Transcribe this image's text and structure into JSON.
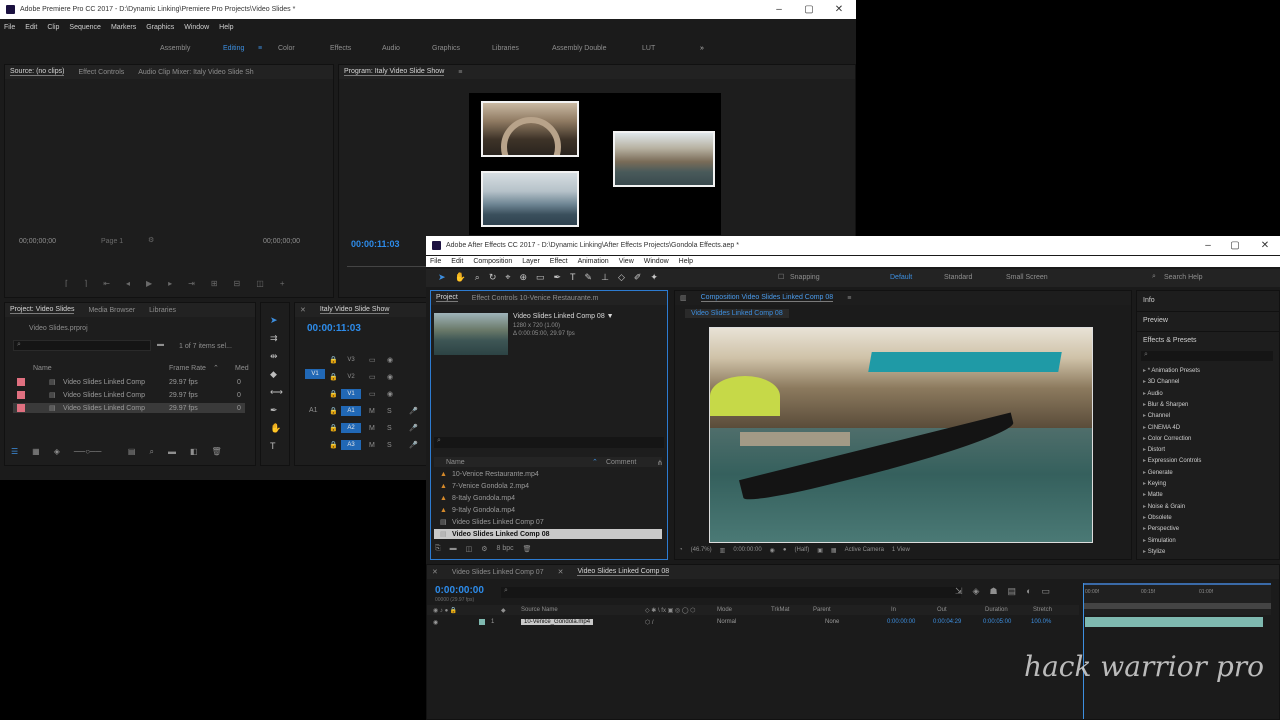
{
  "premiere": {
    "title": "Adobe Premiere Pro CC 2017 - D:\\Dynamic Linking\\Premiere Pro Projects\\Video Slides *",
    "menu": [
      "File",
      "Edit",
      "Clip",
      "Sequence",
      "Markers",
      "Graphics",
      "Window",
      "Help"
    ],
    "workspaces": [
      "Assembly",
      "Editing",
      "Color",
      "Effects",
      "Audio",
      "Graphics",
      "Libraries",
      "Assembly Double",
      "LUT"
    ],
    "source_tabs": [
      "Source: (no clips)",
      "Effect Controls",
      "Audio Clip Mixer: Italy Video Slide Sh"
    ],
    "program_tab": "Program: Italy Video Slide Show",
    "source_tc_left": "00;00;00;00",
    "source_fit": "Page 1",
    "source_tc_right": "00;00;00;00",
    "program_tc": "00:00:11:03",
    "project_tabs": [
      "Project: Video Slides",
      "Media Browser",
      "Libraries"
    ],
    "project_file": "Video Slides.prproj",
    "item_count": "1 of 7 items sel...",
    "project_cols": {
      "name": "Name",
      "frame_rate": "Frame Rate",
      "media": "Med"
    },
    "project_items": [
      {
        "name": "Video Slides Linked Comp",
        "fps": "29.97 fps",
        "m": "0",
        "color": "#e07080"
      },
      {
        "name": "Video Slides Linked Comp",
        "fps": "29.97 fps",
        "m": "0",
        "color": "#e07080"
      },
      {
        "name": "Video Slides Linked Comp",
        "fps": "29.97 fps",
        "m": "0",
        "color": "#e07080"
      }
    ],
    "seq_tab": "Italy Video Slide Show",
    "seq_tc": "00:00:11:03",
    "tracks": [
      "V3",
      "V2",
      "V1",
      "A1",
      "A2",
      "A3"
    ],
    "track_side": [
      "V1",
      "A1"
    ]
  },
  "ae": {
    "title": "Adobe After Effects CC 2017 - D:\\Dynamic Linking\\After Effects Projects\\Gondola Effects.aep *",
    "menu": [
      "File",
      "Edit",
      "Composition",
      "Layer",
      "Effect",
      "Animation",
      "View",
      "Window",
      "Help"
    ],
    "snapping": "Snapping",
    "workspaces": [
      "Default",
      "Standard",
      "Small Screen"
    ],
    "search_help": "Search Help",
    "project_tab": "Project",
    "effect_controls_tab": "Effect Controls 10-Venice Restaurante.m",
    "comp_info": {
      "name": "Video Slides Linked Comp 08 ▼",
      "line1": "1280 x 720 (1.00)",
      "line2": "Δ 0:00:05:00, 29.97 fps"
    },
    "project_cols": {
      "name": "Name",
      "comment": "Comment"
    },
    "project_items": [
      "10-Venice Restaurante.mp4",
      "7-Venice Gondola 2.mp4",
      "8-Italy Gondola.mp4",
      "9-Italy Gondola.mp4",
      "Video Slides Linked Comp 07",
      "Video Slides Linked Comp 08"
    ],
    "project_footer": "8 bpc",
    "comp_tab": "Composition Video Slides Linked Comp 08",
    "comp_subtab": "Video Slides Linked Comp 08",
    "viewer_zoom": "(46.7%)",
    "viewer_tc": "0:00:00:00",
    "viewer_res": "(Half)",
    "viewer_camera": "Active Camera",
    "viewer_view": "1 View",
    "right_panels": [
      "Info",
      "Preview",
      "Effects & Presets"
    ],
    "effect_categories": [
      "* Animation Presets",
      "3D Channel",
      "Audio",
      "Blur & Sharpen",
      "Channel",
      "CINEMA 4D",
      "Color Correction",
      "Distort",
      "Expression Controls",
      "Generate",
      "Keying",
      "Matte",
      "Noise & Grain",
      "Obsolete",
      "Perspective",
      "Simulation",
      "Stylize"
    ],
    "timeline_tabs": [
      "Video Slides Linked Comp 07",
      "Video Slides Linked Comp 08"
    ],
    "timeline_tc": "0:00:00:00",
    "timeline_fps": "00000 (29.97 fps)",
    "layer_cols": [
      "Source Name",
      "Mode",
      "TrkMat",
      "Parent",
      "In",
      "Out",
      "Duration",
      "Stretch"
    ],
    "layer": {
      "num": "1",
      "name": "10-Venice_Gondola.mp4",
      "mode": "Normal",
      "parent": "None",
      "in": "0:00:00:00",
      "out": "0:00:04:29",
      "duration": "0:00:05:00",
      "stretch": "100.0%"
    },
    "ruler": [
      "00:00f",
      "00:15f",
      "01:00f"
    ]
  },
  "watermark": "hack warrior pro",
  "colors": {
    "accent": "#2d8ceb",
    "teal": "#7fb9b0",
    "timecode": "#2d8ceb"
  }
}
